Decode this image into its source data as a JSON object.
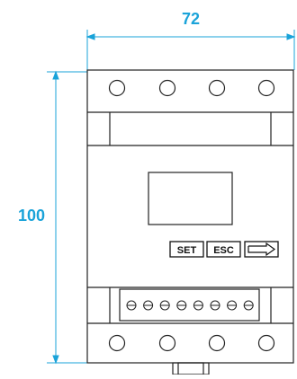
{
  "dimensions": {
    "width_label": "72",
    "height_label": "100",
    "color": "#1aa3d9"
  },
  "device": {
    "top_terminal_count": 4,
    "bottom_terminal_count": 4,
    "connector_pin_count": 8,
    "buttons": {
      "set_label": "SET",
      "esc_label": "ESC",
      "arrow_icon": "right-arrow-icon"
    },
    "outline_color": "#222222"
  }
}
